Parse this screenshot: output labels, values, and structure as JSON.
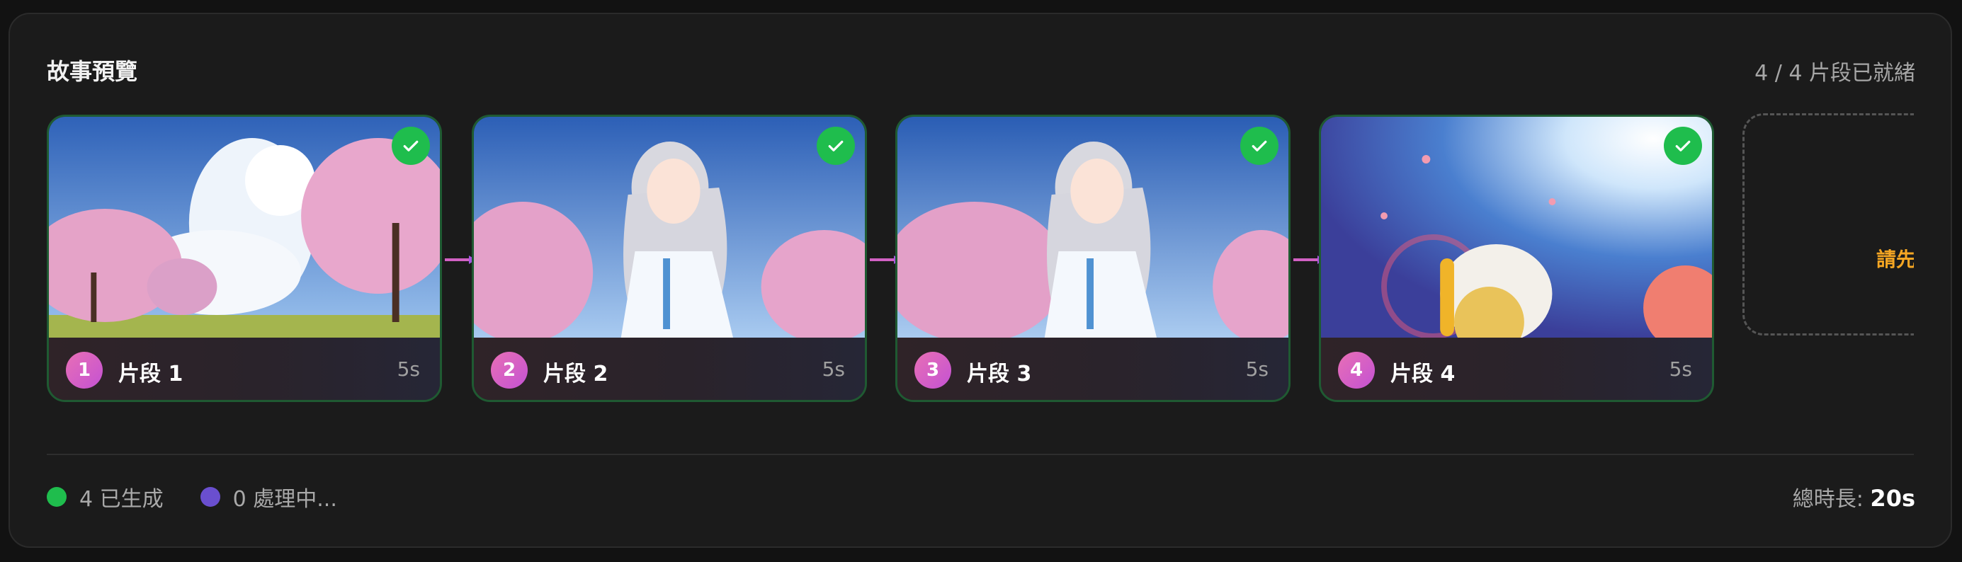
{
  "header": {
    "title": "故事預覽",
    "ready_status": "4 / 4 片段已就緒"
  },
  "segments": [
    {
      "number": "1",
      "label": "片段 1",
      "duration": "5s",
      "status": "complete"
    },
    {
      "number": "2",
      "label": "片段 2",
      "duration": "5s",
      "status": "complete"
    },
    {
      "number": "3",
      "label": "片段 3",
      "duration": "5s",
      "status": "complete"
    },
    {
      "number": "4",
      "label": "片段 4",
      "duration": "5s",
      "status": "complete"
    }
  ],
  "placeholder": {
    "text": "請先"
  },
  "footer": {
    "generated_text": "4 已生成",
    "processing_text": "0 處理中...",
    "total_label": "總時長: ",
    "total_value": "20s"
  },
  "colors": {
    "accent_green": "#1fbd4d",
    "accent_purple": "#6a4fcf",
    "badge_pink": "#e86fb5",
    "placeholder_orange": "#f5a623",
    "card_border": "#1f5a32"
  },
  "icons": {
    "check": "check-icon",
    "connector": "arrow-right-icon"
  }
}
